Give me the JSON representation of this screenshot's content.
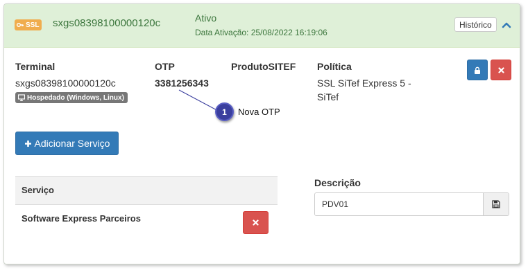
{
  "header": {
    "ssl_badge": "SSL",
    "code": "sxgs08398100000120c",
    "status": "Ativo",
    "activation_date": "Data Ativação: 25/08/2022 16:19:06",
    "historico_label": "Histórico"
  },
  "details": {
    "terminal_label": "Terminal",
    "terminal_value": "sxgs08398100000120c",
    "hosted_badge": "Hospedado (Windows, Linux)",
    "otp_label": "OTP",
    "otp_value": "3381256343",
    "produto_label": "ProdutoSITEF",
    "politica_label": "Política",
    "politica_line1": "SSL SiTef Express 5 -",
    "politica_line2": "SiTef"
  },
  "callout": {
    "number": "1",
    "text": "Nova OTP"
  },
  "actions": {
    "add_service_label": "Adicionar Serviço"
  },
  "services": {
    "header_label": "Serviço",
    "rows": [
      {
        "name": "Software Express Parceiros"
      }
    ]
  },
  "descricao": {
    "label": "Descrição",
    "value": "PDV01"
  },
  "icons": {
    "ssl": "key-icon",
    "hosted": "monitor-icon",
    "collapse": "chevron-up-icon",
    "lock": "lock-icon",
    "delete": "close-icon",
    "add": "plus-icon",
    "save": "floppy-disk-icon"
  },
  "colors": {
    "header_bg": "#dff0d8",
    "header_text": "#3c763d",
    "primary": "#337ab7",
    "danger": "#d9534f",
    "warning": "#f0ad4e",
    "callout": "#3b3f9e"
  }
}
